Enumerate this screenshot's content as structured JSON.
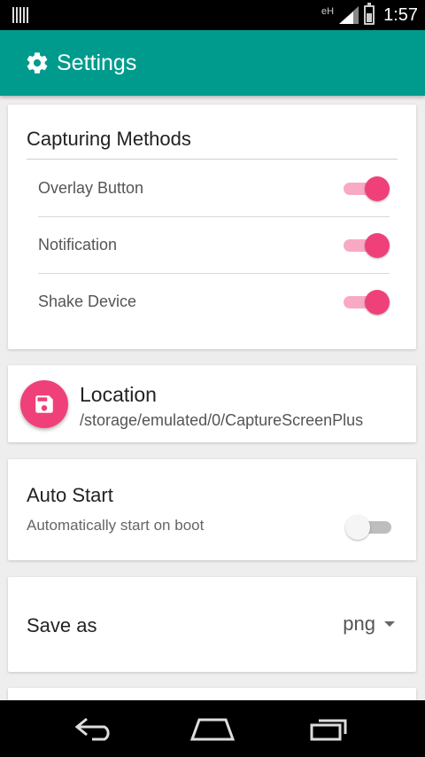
{
  "status_bar": {
    "network": "eH",
    "time": "1:57"
  },
  "app_bar": {
    "icon": "gear-icon",
    "title": "Settings"
  },
  "capturing_methods": {
    "title": "Capturing Methods",
    "items": [
      {
        "label": "Overlay Button",
        "enabled": true
      },
      {
        "label": "Notification",
        "enabled": true
      },
      {
        "label": "Shake Device",
        "enabled": true
      }
    ]
  },
  "location": {
    "icon": "save-icon",
    "title": "Location",
    "path": "/storage/emulated/0/CaptureScreenPlus"
  },
  "auto_start": {
    "title": "Auto Start",
    "subtitle": "Automatically start on boot",
    "enabled": false
  },
  "save_as": {
    "label": "Save as",
    "value": "png"
  },
  "colors": {
    "primary": "#009b8c",
    "accent": "#f0407a",
    "accent_track": "#f8aac4"
  },
  "nav_bar": {
    "icons": [
      "back-icon",
      "home-icon",
      "recent-apps-icon"
    ]
  }
}
